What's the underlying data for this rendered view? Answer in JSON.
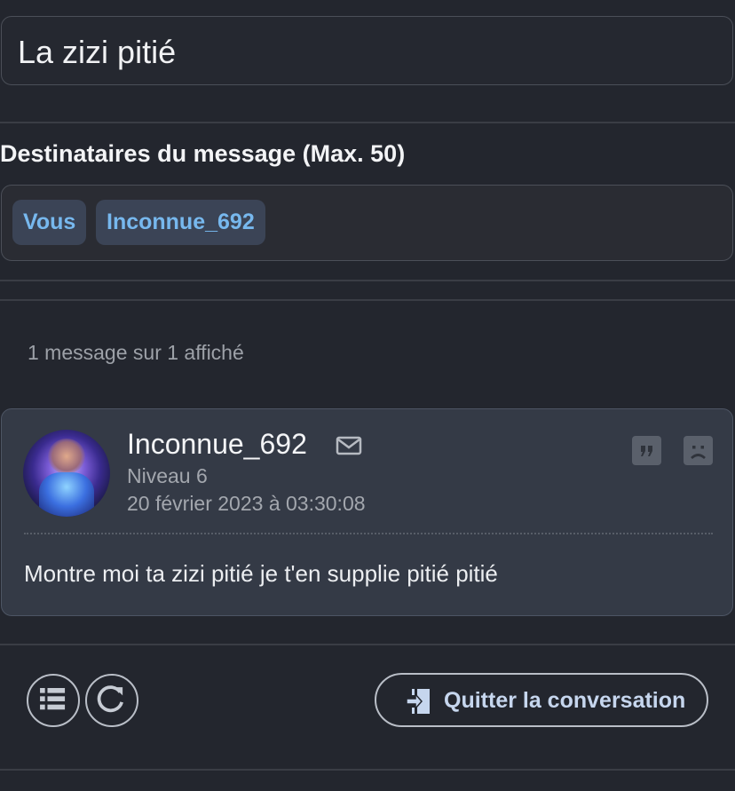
{
  "conversation": {
    "title": "La zizi pitié"
  },
  "recipients": {
    "label": "Destinataires du message (Max. 50)",
    "chips": [
      "Vous",
      "Inconnue_692"
    ]
  },
  "messages_count": "1 message sur 1 affiché",
  "message": {
    "author": "Inconnue_692",
    "level": "Niveau 6",
    "date": "20 février 2023 à 03:30:08",
    "body": "Montre moi ta zizi pitié je t'en supplie pitié pitié",
    "icons": [
      "mail-icon",
      "quote-icon",
      "sad-face-icon"
    ]
  },
  "footer": {
    "list_button_icon": "list-icon",
    "refresh_button_icon": "refresh-icon",
    "quit_label": "Quitter la conversation",
    "quit_icon": "exit-door-icon"
  },
  "colors": {
    "background": "#23262e",
    "chip_text": "#77b8ee",
    "card_bg": "#343a46"
  }
}
